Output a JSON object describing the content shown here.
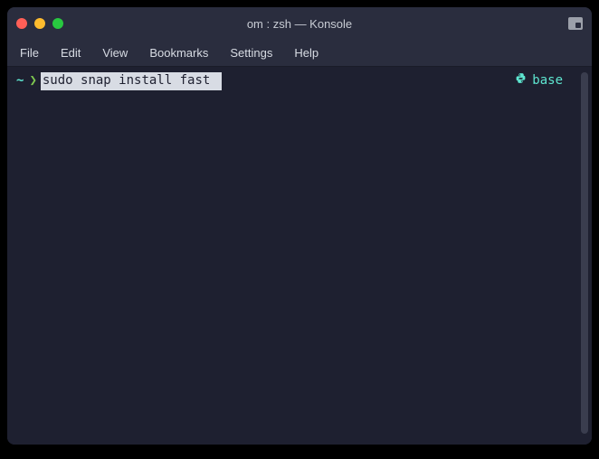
{
  "window": {
    "title": "om : zsh — Konsole"
  },
  "menubar": {
    "items": [
      "File",
      "Edit",
      "View",
      "Bookmarks",
      "Settings",
      "Help"
    ]
  },
  "terminal": {
    "prompt_tilde": "~",
    "prompt_angle": "❯",
    "command": "sudo snap install fast ",
    "env_label": "base"
  }
}
